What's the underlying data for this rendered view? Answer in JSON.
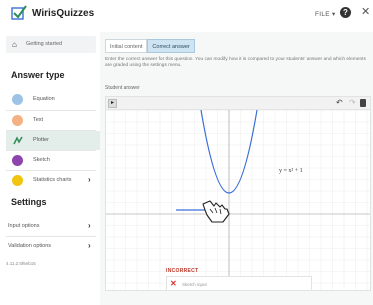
{
  "header": {
    "app_title": "WirisQuizzes",
    "file_label": "FILE",
    "file_caret": "▾",
    "help_label": "?",
    "close_label": "✕"
  },
  "sidebar": {
    "getting_started": "Getting started",
    "answer_type_title": "Answer type",
    "answer_types": [
      {
        "label": "Equation",
        "color": "#9cc3e6",
        "glyph": "=",
        "active": false,
        "has_arrow": false
      },
      {
        "label": "Text",
        "color": "#f4b183",
        "glyph": "✎",
        "active": false,
        "has_arrow": false
      },
      {
        "label": "Plotter",
        "color": "#2e8b57",
        "glyph": "↯",
        "active": true,
        "has_arrow": false
      },
      {
        "label": "Sketch",
        "color": "#8e44ad",
        "glyph": "✏",
        "active": false,
        "has_arrow": false
      },
      {
        "label": "Statistics charts",
        "color": "#f1c40f",
        "glyph": "▤",
        "active": false,
        "has_arrow": true
      }
    ],
    "settings_title": "Settings",
    "settings_items": [
      {
        "label": "Input options",
        "arrow": "›"
      },
      {
        "label": "Validation options",
        "arrow": "›"
      }
    ],
    "version": "4.11.2.5f6eb15"
  },
  "main": {
    "tabs": [
      {
        "label": "Initial content",
        "active": false
      },
      {
        "label": "Correct answer",
        "active": true
      }
    ],
    "description": "Enter the correct answer for this question. You can modify how it is compared to your students' answer and which elements are graded using the settings menu.",
    "student_answer_label": "Student answer",
    "plot_label": "y = x² + 1",
    "feedback_label": "INCORRECT",
    "feedback_text": "Sketch input"
  },
  "colors": {
    "accent": "#2e8b57",
    "curve": "#3a6fd8",
    "incorrect": "#c0392b"
  }
}
